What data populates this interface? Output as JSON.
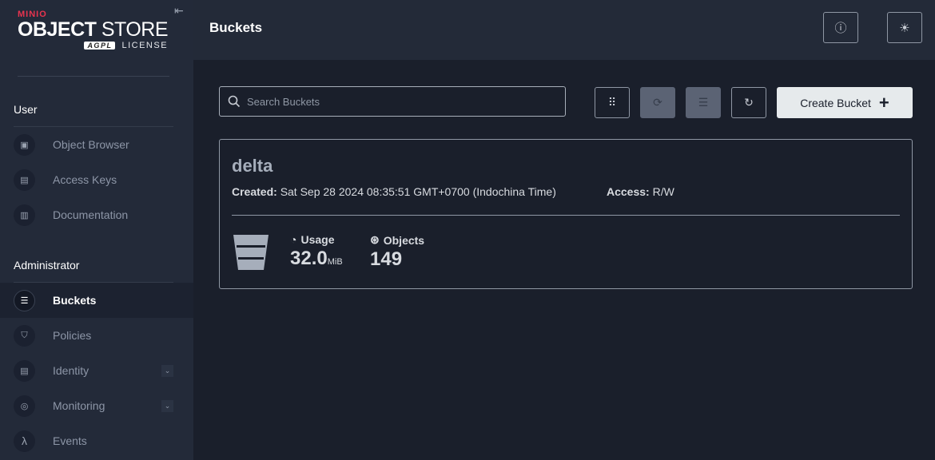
{
  "brand": {
    "maker": "MINIO",
    "product_bold": "OBJECT",
    "product_light": "STORE",
    "license_badge": "AGPL",
    "license": "LICENSE"
  },
  "sidebar": {
    "sections": [
      {
        "label": "User"
      },
      {
        "label": "Administrator"
      }
    ],
    "user_items": [
      {
        "label": "Object Browser",
        "icon": "object-browser-icon"
      },
      {
        "label": "Access Keys",
        "icon": "key-icon"
      },
      {
        "label": "Documentation",
        "icon": "docs-icon"
      }
    ],
    "admin_items": [
      {
        "label": "Buckets",
        "icon": "bucket-icon",
        "active": true
      },
      {
        "label": "Policies",
        "icon": "shield-icon"
      },
      {
        "label": "Identity",
        "icon": "id-card-icon",
        "expandable": true
      },
      {
        "label": "Monitoring",
        "icon": "monitoring-icon",
        "expandable": true
      },
      {
        "label": "Events",
        "icon": "lambda-icon",
        "glyph": "λ"
      }
    ]
  },
  "header": {
    "title": "Buckets"
  },
  "toolbar": {
    "search_placeholder": "Search Buckets",
    "create_label": "Create Bucket"
  },
  "buckets": [
    {
      "name": "delta",
      "created_label": "Created:",
      "created": "Sat Sep 28 2024 08:35:51 GMT+0700 (Indochina Time)",
      "access_label": "Access:",
      "access": "R/W",
      "usage_label": "Usage",
      "usage_value": "32.0",
      "usage_unit": "MiB",
      "objects_label": "Objects",
      "objects_value": "149"
    }
  ],
  "colors": {
    "accent": "#e8344f",
    "sidebar_bg": "#232a39",
    "content_bg": "#1a1f2b"
  }
}
